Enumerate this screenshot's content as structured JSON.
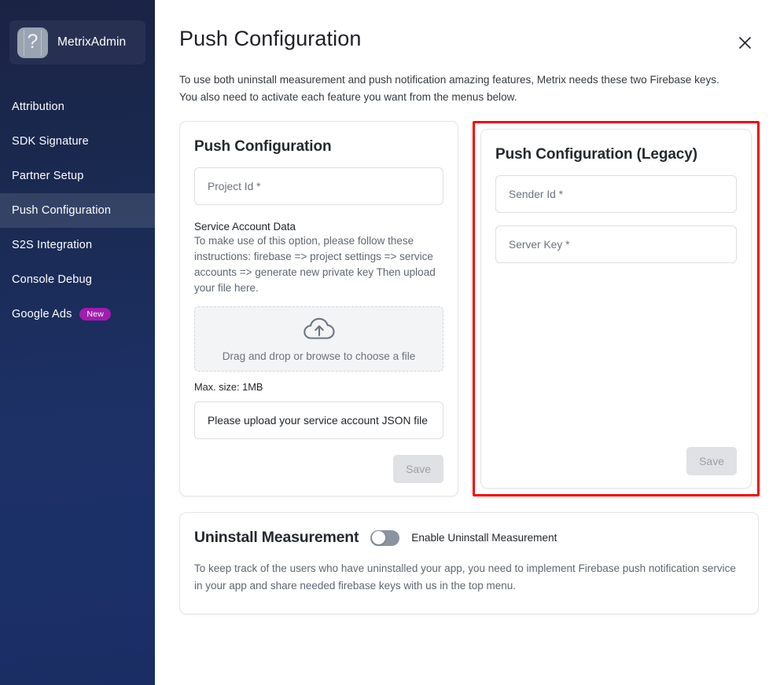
{
  "sidebar": {
    "brand": {
      "name": "MetrixAdmin",
      "logo_icon": "image-placeholder-icon",
      "logo_glyph": "?"
    },
    "items": [
      {
        "label": "Attribution",
        "active": false,
        "badge": ""
      },
      {
        "label": "SDK Signature",
        "active": false,
        "badge": ""
      },
      {
        "label": "Partner Setup",
        "active": false,
        "badge": ""
      },
      {
        "label": "Push Configuration",
        "active": true,
        "badge": ""
      },
      {
        "label": "S2S Integration",
        "active": false,
        "badge": ""
      },
      {
        "label": "Console Debug",
        "active": false,
        "badge": ""
      },
      {
        "label": "Google Ads",
        "active": false,
        "badge": "New"
      }
    ]
  },
  "header": {
    "title": "Push Configuration",
    "close_icon": "close-icon",
    "intro": "To use both uninstall measurement and push notification amazing features, Metrix needs these two Firebase keys. You also need to activate each feature you want from the menus below."
  },
  "push_card": {
    "title": "Push Configuration",
    "project_id_placeholder": "Project Id *",
    "service_account_label": "Service Account Data",
    "service_account_desc": "To make use of this option, please follow these instructions: firebase => project settings => service accounts => generate new private key Then upload your file here.",
    "dropzone_icon": "cloud-upload-icon",
    "dropzone_text": "Drag and drop or browse to choose a file",
    "max_size": "Max. size: 1MB",
    "upload_status": "Please upload your service account JSON file",
    "save_label": "Save"
  },
  "legacy_card": {
    "title": "Push Configuration (Legacy)",
    "sender_id_placeholder": "Sender Id *",
    "server_key_placeholder": "Server Key *",
    "save_label": "Save",
    "highlight_color": "#fa0000"
  },
  "uninstall_card": {
    "title": "Uninstall Measurement",
    "toggle_label": "Enable Uninstall Measurement",
    "toggle_state": "off",
    "description": "To keep track of the users who have uninstalled your app, you need to implement Firebase push notification service in your app and share needed firebase keys with us in the top menu."
  },
  "colors": {
    "sidebar_top": "#1b2344",
    "sidebar_bottom": "#1a2d63",
    "badge_new": "#a21caf",
    "annotation_red": "#fa0000"
  }
}
